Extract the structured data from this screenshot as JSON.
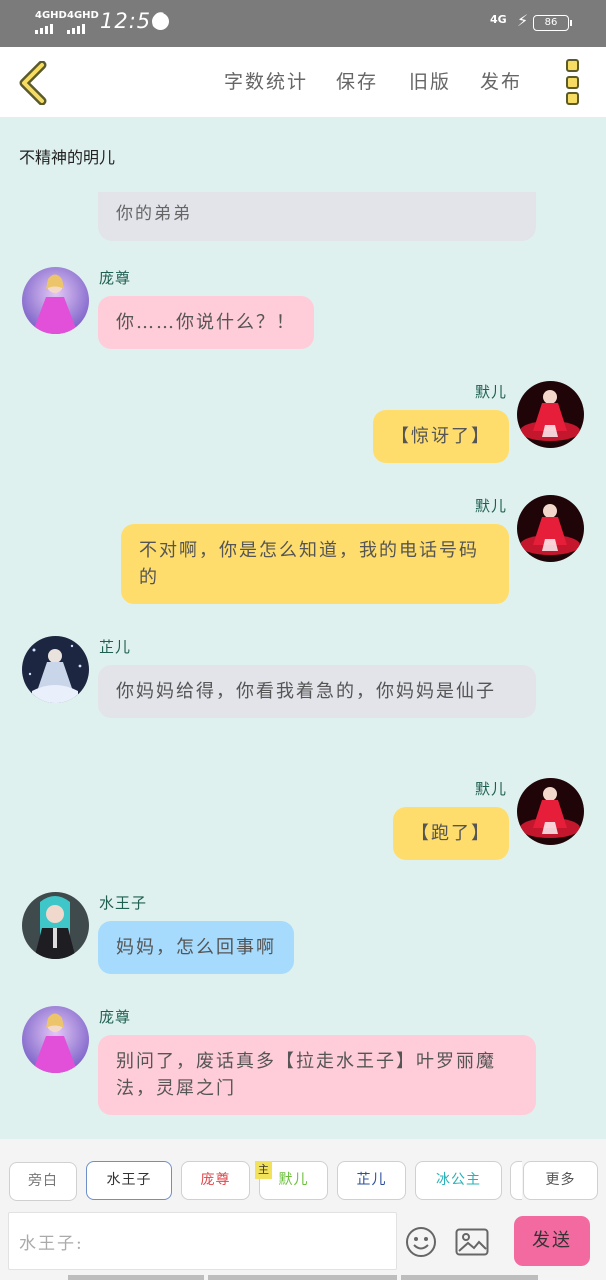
{
  "status_bar": {
    "signal1": "4GHD",
    "signal2": "4GHD",
    "time": "12:56",
    "network": "4G",
    "battery": "86"
  },
  "header": {
    "items": [
      "字数统计",
      "保存",
      "旧版",
      "发布"
    ]
  },
  "chat": {
    "story_title": "不精神的明儿",
    "partial_message": "你的弟弟",
    "messages": [
      {
        "side": "left",
        "name": "庞尊",
        "text": "你……你说什么？！",
        "color": "#ffcdd9"
      },
      {
        "side": "right",
        "name": "默儿",
        "text": "【惊讶了】",
        "color": "#fedd6d"
      },
      {
        "side": "right",
        "name": "默儿",
        "text": "不对啊，你是怎么知道，我的电话号码的",
        "color": "#fedd6d"
      },
      {
        "side": "left",
        "name": "芷儿",
        "text": "你妈妈给得，你看我着急的，你妈妈是仙子",
        "color": "#e3e4ea"
      },
      {
        "side": "right",
        "name": "默儿",
        "text": "【跑了】",
        "color": "#fedd6d"
      },
      {
        "side": "left",
        "name": "水王子",
        "text": "妈妈，怎么回事啊",
        "color": "#a6dbfd"
      },
      {
        "side": "left",
        "name": "庞尊",
        "text": "别问了，废话真多【拉走水王子】叶罗丽魔法，灵犀之门",
        "color": "#ffcdd9"
      }
    ]
  },
  "composer": {
    "characters": [
      {
        "label": "旁白",
        "color": "#777777"
      },
      {
        "label": "水王子",
        "color": "#333333"
      },
      {
        "label": "庞尊",
        "color": "#e0474c"
      },
      {
        "label": "默儿",
        "color": "#6cbf3c"
      },
      {
        "label": "芷儿",
        "color": "#2b4f9c"
      },
      {
        "label": "冰公主",
        "color": "#28b1b8"
      }
    ],
    "main_badge": "主",
    "more_label": "更多",
    "input_prefix": "水王子:",
    "send_label": "发送"
  }
}
